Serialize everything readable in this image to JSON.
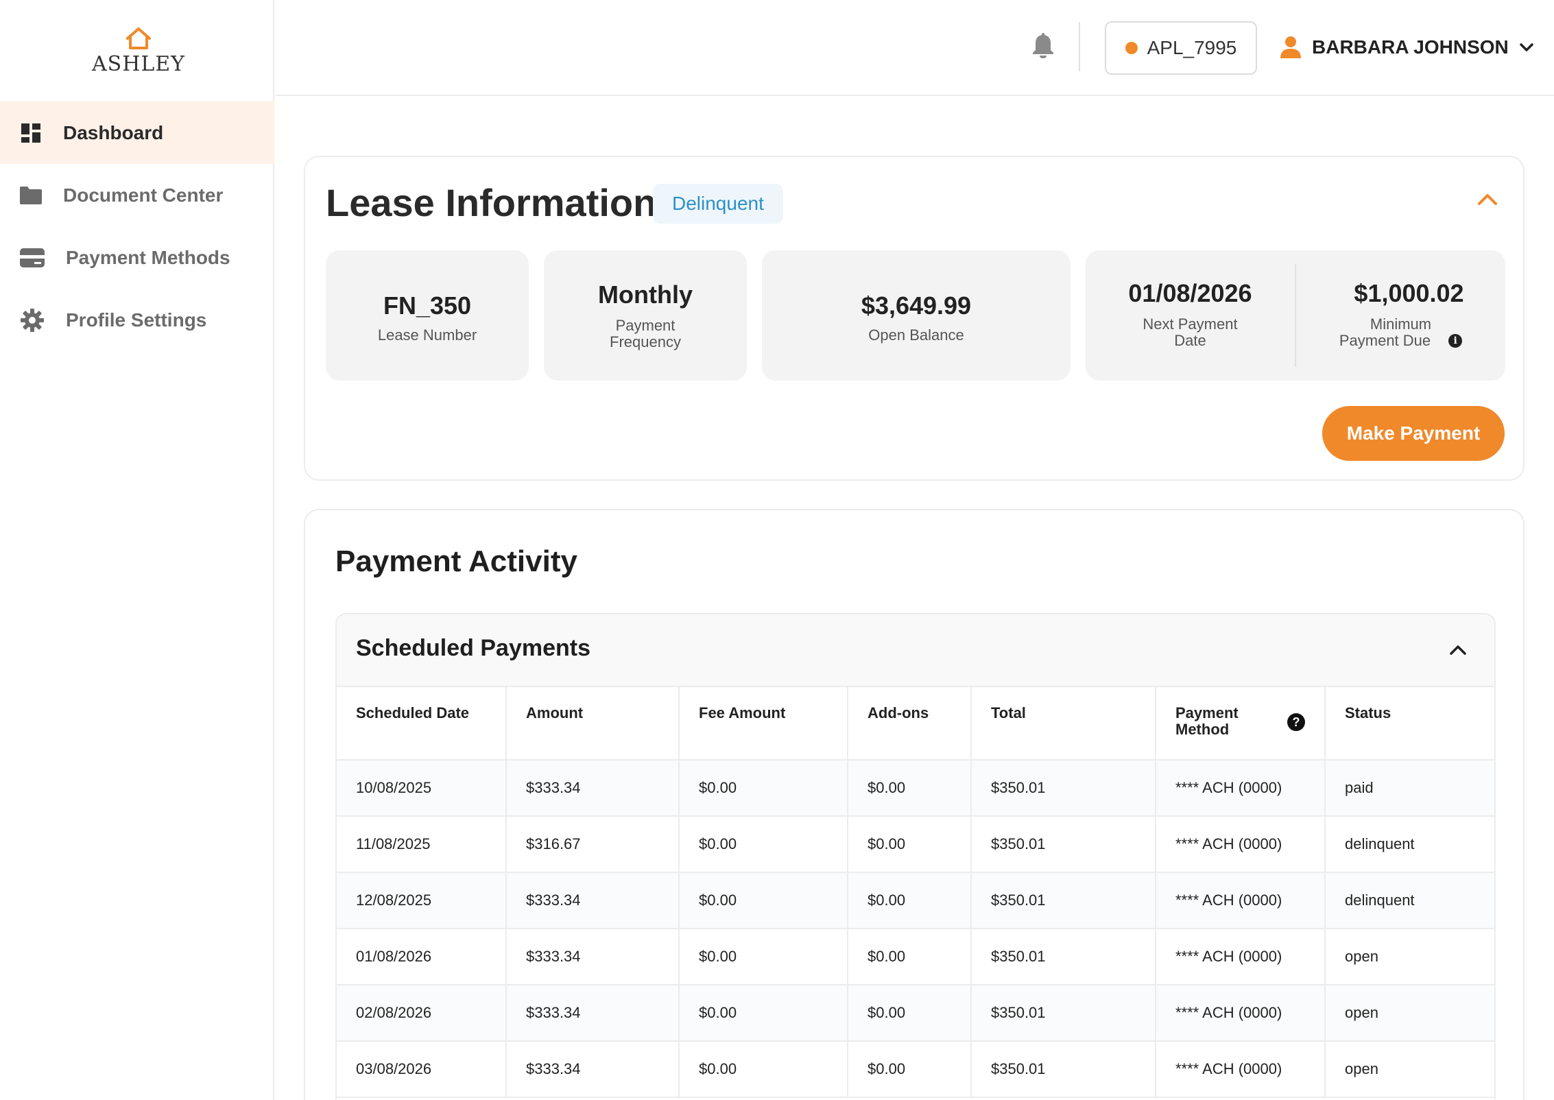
{
  "brand": {
    "name": "ASHLEY",
    "accent": "#f0892a"
  },
  "sidebar": {
    "items": [
      {
        "label": "Dashboard",
        "icon": "dashboard-icon",
        "active": true
      },
      {
        "label": "Document Center",
        "icon": "folder-icon",
        "active": false
      },
      {
        "label": "Payment Methods",
        "icon": "card-icon",
        "active": false
      },
      {
        "label": "Profile Settings",
        "icon": "gear-icon",
        "active": false
      }
    ]
  },
  "header": {
    "account_id": "APL_7995",
    "user_name": "BARBARA JOHNSON"
  },
  "lease": {
    "title": "Lease Information",
    "status_badge": "Delinquent",
    "tiles": {
      "lease_number": {
        "value": "FN_350",
        "label": "Lease Number"
      },
      "frequency": {
        "value": "Monthly",
        "label_line1": "Payment",
        "label_line2": "Frequency"
      },
      "open_balance": {
        "value": "$3,649.99",
        "label": "Open Balance"
      },
      "next_payment": {
        "value": "01/08/2026",
        "label_line1": "Next Payment",
        "label_line2": "Date"
      },
      "minimum_due": {
        "value": "$1,000.02",
        "label_line1": "Minimum",
        "label_line2": "Payment Due"
      }
    },
    "make_payment_label": "Make Payment"
  },
  "activity": {
    "title": "Payment Activity",
    "scheduled": {
      "title": "Scheduled Payments",
      "columns": {
        "date": "Scheduled Date",
        "amount": "Amount",
        "fee": "Fee Amount",
        "addons": "Add-ons",
        "total": "Total",
        "method_line1": "Payment",
        "method_line2": "Method",
        "status": "Status"
      },
      "rows": [
        [
          "10/08/2025",
          "$333.34",
          "$0.00",
          "$0.00",
          "$350.01",
          "**** ACH (0000)",
          "paid"
        ],
        [
          "11/08/2025",
          "$316.67",
          "$0.00",
          "$0.00",
          "$350.01",
          "**** ACH (0000)",
          "delinquent"
        ],
        [
          "12/08/2025",
          "$333.34",
          "$0.00",
          "$0.00",
          "$350.01",
          "**** ACH (0000)",
          "delinquent"
        ],
        [
          "01/08/2026",
          "$333.34",
          "$0.00",
          "$0.00",
          "$350.01",
          "**** ACH (0000)",
          "open"
        ],
        [
          "02/08/2026",
          "$333.34",
          "$0.00",
          "$0.00",
          "$350.01",
          "**** ACH (0000)",
          "open"
        ],
        [
          "03/08/2026",
          "$333.34",
          "$0.00",
          "$0.00",
          "$350.01",
          "**** ACH (0000)",
          "open"
        ]
      ]
    }
  }
}
